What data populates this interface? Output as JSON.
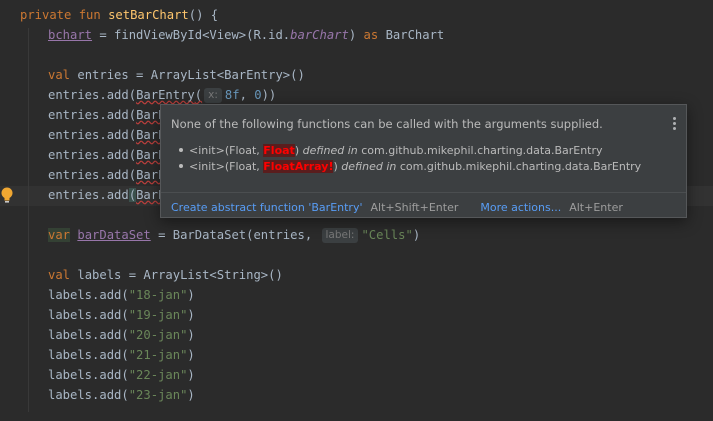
{
  "code": {
    "line1": {
      "kw": "private fun ",
      "fn": "setBarChart",
      "rest": "() {"
    },
    "line2": {
      "prop": "bchart",
      "mid": " = findViewById<View>(R.id.",
      "id": "barChart",
      "tail": ") ",
      "as": "as",
      "type": " BarChart"
    },
    "line4": {
      "kw": "val ",
      "rest": "entries = ArrayList<BarEntry>()"
    },
    "line5": {
      "pre": "entries.add(",
      "cls": "BarEntry",
      "open": "(",
      "hint_label": "x:",
      "num1": "8f",
      "comma": ", ",
      "num2": "0",
      "close": "))"
    },
    "line6": {
      "pre": "entries.add(",
      "cls": "BarE"
    },
    "line7": {
      "pre": "entries.add(",
      "cls": "BarE"
    },
    "line8": {
      "pre": "entries.add(",
      "cls": "BarE"
    },
    "line9": {
      "pre": "entries.add(",
      "cls": "BarE"
    },
    "line10": {
      "pre": "entries.add",
      "paren": "(",
      "cls": "BarE"
    },
    "line12": {
      "kw": "var",
      "space": " ",
      "prop": "barDataSet",
      "mid": " = BarDataSet(entries, ",
      "hint_label": "label:",
      "str": "\"Cells\"",
      "close": ")"
    },
    "line14": {
      "kw": "val ",
      "rest": "labels = ArrayList<String>()"
    },
    "labels": [
      {
        "pre": "labels.add(",
        "str": "\"18-jan\"",
        "close": ")"
      },
      {
        "pre": "labels.add(",
        "str": "\"19-jan\"",
        "close": ")"
      },
      {
        "pre": "labels.add(",
        "str": "\"20-jan\"",
        "close": ")"
      },
      {
        "pre": "labels.add(",
        "str": "\"21-jan\"",
        "close": ")"
      },
      {
        "pre": "labels.add(",
        "str": "\"22-jan\"",
        "close": ")"
      },
      {
        "pre": "labels.add(",
        "str": "\"23-jan\"",
        "close": ")"
      }
    ]
  },
  "popup": {
    "title": "None of the following functions can be called with the arguments supplied.",
    "candidates": [
      {
        "pre": "<init>(Float, ",
        "bad": "Float",
        "post": ") ",
        "def": "defined in",
        "pkg": " com.github.mikephil.charting.data.BarEntry"
      },
      {
        "pre": "<init>(Float, ",
        "bad": "FloatArray!",
        "post": ") ",
        "def": "defined in",
        "pkg": " com.github.mikephil.charting.data.BarEntry"
      }
    ],
    "action1": "Create abstract function 'BarEntry'",
    "action1_shortcut": "Alt+Shift+Enter",
    "action2": "More actions...",
    "action2_shortcut": "Alt+Enter"
  },
  "icons": {
    "bulb": "lightbulb-icon",
    "more": "more-vertical-icon"
  },
  "colors": {
    "keyword": "#cc7832",
    "function": "#ffc66d",
    "property": "#9876aa",
    "number": "#6897bb",
    "string": "#6a8759",
    "error": "#ff0000",
    "link": "#589df6"
  }
}
